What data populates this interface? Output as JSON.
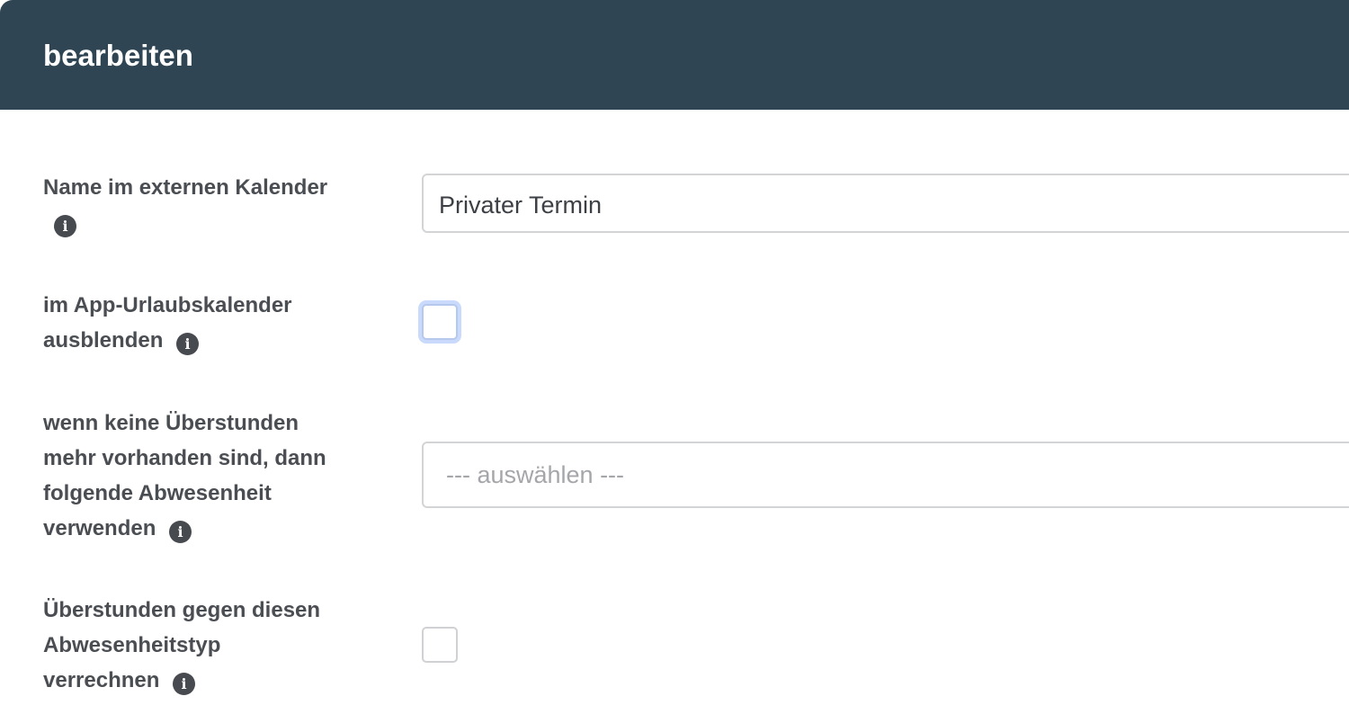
{
  "header": {
    "title": "bearbeiten"
  },
  "fields": {
    "calendar_name": {
      "label": "Name im externen Kalender",
      "value": "Privater Termin"
    },
    "hide_in_app_calendar": {
      "label_line1": "im App-Urlaubskalender",
      "label_line2": "ausblenden",
      "checked": false
    },
    "fallback_absence": {
      "label_line1": "wenn keine Überstunden",
      "label_line2": "mehr vorhanden sind, dann",
      "label_line3": "folgende Abwesenheit",
      "label_line4": "verwenden",
      "placeholder": "--- auswählen ---"
    },
    "offset_overtime": {
      "label_line1": "Überstunden gegen diesen",
      "label_line2": "Abwesenheitstyp",
      "label_line3": "verrechnen",
      "checked": false
    }
  },
  "icons": {
    "info": "info-circle-icon",
    "info_glyph": "i"
  },
  "colors": {
    "header_bg": "#2f4553",
    "label_text": "#4a4d52",
    "focus_ring": "#c9dafc"
  }
}
